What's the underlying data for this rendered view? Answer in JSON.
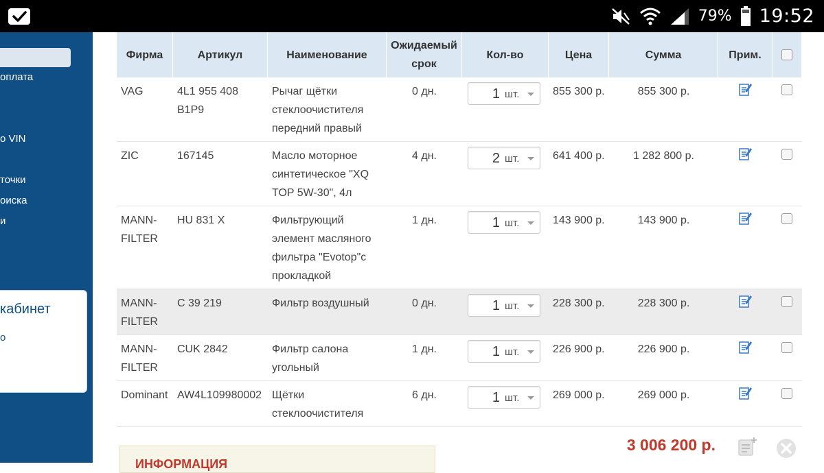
{
  "statusbar": {
    "battery": "79%",
    "time": "19:52",
    "icons": [
      "app-check-icon",
      "mute-icon",
      "wifi-icon",
      "signal-icon",
      "battery-icon"
    ]
  },
  "sidebar": {
    "links": [
      "оплата",
      "о VIN",
      "точки",
      "оиска",
      "и"
    ],
    "card_title": "кабинет",
    "card_line": "о"
  },
  "table": {
    "headers": {
      "firm": "Фирма",
      "article": "Артикул",
      "name": "Наименование",
      "term": "Ожидаемый срок",
      "qty": "Кол-во",
      "price": "Цена",
      "sum": "Сумма",
      "note": "Прим."
    },
    "rows": [
      {
        "firm": "VAG",
        "article": "4L1 955 408 B1P9",
        "name": "Рычаг щётки стеклоочистителя передний правый",
        "term": "0 дн.",
        "qty": "1",
        "unit": "шт.",
        "price": "855 300 р.",
        "sum": "855 300 р."
      },
      {
        "firm": "ZIC",
        "article": "167145",
        "name": "Масло моторное синтетическое \"XQ TOP 5W-30\", 4л",
        "term": "4 дн.",
        "qty": "2",
        "unit": "шт.",
        "price": "641 400 р.",
        "sum": "1 282 800 р."
      },
      {
        "firm": "MANN-FILTER",
        "article": "HU 831 X",
        "name": "Фильтрующий элемент масляного фильтра \"Evotop\"с прокладкой",
        "term": "1 дн.",
        "qty": "1",
        "unit": "шт.",
        "price": "143 900 р.",
        "sum": "143 900 р."
      },
      {
        "firm": "MANN-FILTER",
        "article": "C 39 219",
        "name": "Фильтр воздушный",
        "term": "0 дн.",
        "qty": "1",
        "unit": "шт.",
        "price": "228 300 р.",
        "sum": "228 300 р."
      },
      {
        "firm": "MANN-FILTER",
        "article": "CUK 2842",
        "name": "Фильтр салона угольный",
        "term": "1 дн.",
        "qty": "1",
        "unit": "шт.",
        "price": "226 900 р.",
        "sum": "226 900 р."
      },
      {
        "firm": "Dominant",
        "article": "AW4L109980002",
        "name": "Щётки стеклоочистителя",
        "term": "6 дн.",
        "qty": "1",
        "unit": "шт.",
        "price": "269 000 р.",
        "sum": "269 000 р."
      }
    ]
  },
  "footer": {
    "total": "3 006 200 р.",
    "info_title": "ИНФОРМАЦИЯ"
  },
  "colors": {
    "sidebar": "#0f4f86",
    "header_bg": "#dbe7f2",
    "total": "#c0392b",
    "note_icon": "#3a78c4"
  }
}
